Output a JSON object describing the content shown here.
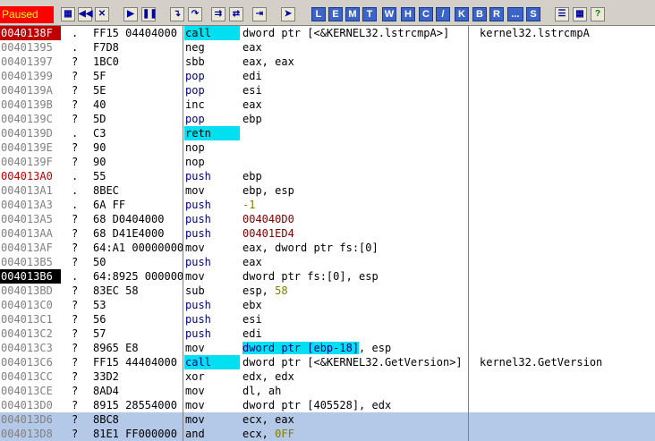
{
  "status": "Paused",
  "toolbar": {
    "buttons": [
      "open-icon",
      "rewind-icon",
      "close-icon",
      "run-icon",
      "pause-icon",
      "step-into-icon",
      "step-over-icon",
      "trace-into-icon",
      "trace-over-icon",
      "execute-till-return-icon",
      "goto-icon"
    ],
    "letters": [
      "L",
      "E",
      "M",
      "T",
      "W",
      "H",
      "C",
      "/",
      "K",
      "B",
      "R",
      "...",
      "S"
    ],
    "right_buttons": [
      "list-icon",
      "grid-icon",
      "help-icon"
    ]
  },
  "rows": [
    {
      "addr": "0040138F",
      "flag": ".",
      "hex": "FF15 04404000",
      "mn": "call",
      "ops": "dword ptr [<&KERNEL32.lstrcmpA>]",
      "cmt": "kernel32.lstrcmpA",
      "addr_style": "hl",
      "mn_style": "cyan"
    },
    {
      "addr": "00401395",
      "flag": ".",
      "hex": "F7D8",
      "mn": "neg",
      "ops": "eax",
      "cmt": ""
    },
    {
      "addr": "00401397",
      "flag": "?",
      "hex": "1BC0",
      "mn": "sbb",
      "ops": "eax, eax",
      "cmt": ""
    },
    {
      "addr": "00401399",
      "flag": "?",
      "hex": "5F",
      "mn": "pop",
      "ops": "edi",
      "cmt": "",
      "mn_style": "blue"
    },
    {
      "addr": "0040139A",
      "flag": "?",
      "hex": "5E",
      "mn": "pop",
      "ops": "esi",
      "cmt": "",
      "mn_style": "blue"
    },
    {
      "addr": "0040139B",
      "flag": "?",
      "hex": "40",
      "mn": "inc",
      "ops": "eax",
      "cmt": ""
    },
    {
      "addr": "0040139C",
      "flag": "?",
      "hex": "5D",
      "mn": "pop",
      "ops": "ebp",
      "cmt": "",
      "mn_style": "blue"
    },
    {
      "addr": "0040139D",
      "flag": ".",
      "hex": "C3",
      "mn": "retn",
      "ops": "",
      "cmt": "",
      "mn_style": "cyan"
    },
    {
      "addr": "0040139E",
      "flag": "?",
      "hex": "90",
      "mn": "nop",
      "ops": "",
      "cmt": ""
    },
    {
      "addr": "0040139F",
      "flag": "?",
      "hex": "90",
      "mn": "nop",
      "ops": "",
      "cmt": ""
    },
    {
      "addr": "004013A0",
      "flag": ".",
      "hex": "55",
      "mn": "push",
      "ops": "ebp",
      "cmt": "",
      "addr_style": "red",
      "mn_style": "blue"
    },
    {
      "addr": "004013A1",
      "flag": ".",
      "hex": "8BEC",
      "mn": "mov",
      "ops": "ebp, esp",
      "cmt": ""
    },
    {
      "addr": "004013A3",
      "flag": ".",
      "hex": "6A FF",
      "mn": "push",
      "ops": "-1",
      "cmt": "",
      "mn_style": "blue",
      "ops_style": "num"
    },
    {
      "addr": "004013A5",
      "flag": "?",
      "hex": "68 D0404000",
      "mn": "push",
      "ops": "004040D0",
      "cmt": "",
      "mn_style": "blue",
      "ops_style": "imm"
    },
    {
      "addr": "004013AA",
      "flag": "?",
      "hex": "68 D41E4000",
      "mn": "push",
      "ops": "00401ED4",
      "cmt": "",
      "mn_style": "blue",
      "ops_style": "imm"
    },
    {
      "addr": "004013AF",
      "flag": "?",
      "hex": "64:A1 00000000",
      "mn": "mov",
      "ops": "eax, dword ptr fs:[0]",
      "cmt": ""
    },
    {
      "addr": "004013B5",
      "flag": "?",
      "hex": "50",
      "mn": "push",
      "ops": "eax",
      "cmt": "",
      "mn_style": "blue"
    },
    {
      "addr": "004013B6",
      "flag": ".",
      "hex": "64:8925 00000000",
      "mn": "mov",
      "ops": "dword ptr fs:[0], esp",
      "cmt": "",
      "addr_style": "blk"
    },
    {
      "addr": "004013BD",
      "flag": "?",
      "hex": "83EC 58",
      "mn": "sub",
      "ops_pre": "esp, ",
      "ops_num": "58",
      "cmt": ""
    },
    {
      "addr": "004013C0",
      "flag": "?",
      "hex": "53",
      "mn": "push",
      "ops": "ebx",
      "cmt": "",
      "mn_style": "blue"
    },
    {
      "addr": "004013C1",
      "flag": "?",
      "hex": "56",
      "mn": "push",
      "ops": "esi",
      "cmt": "",
      "mn_style": "blue"
    },
    {
      "addr": "004013C2",
      "flag": "?",
      "hex": "57",
      "mn": "push",
      "ops": "edi",
      "cmt": "",
      "mn_style": "blue"
    },
    {
      "addr": "004013C3",
      "flag": "?",
      "hex": "8965 E8",
      "mn": "mov",
      "ops_hl": "dword ptr [ebp-18]",
      "ops_post": ", esp",
      "cmt": ""
    },
    {
      "addr": "004013C6",
      "flag": "?",
      "hex": "FF15 44404000",
      "mn": "call",
      "ops": "dword ptr [<&KERNEL32.GetVersion>]",
      "cmt": "kernel32.GetVersion",
      "mn_style": "cyanblue"
    },
    {
      "addr": "004013CC",
      "flag": "?",
      "hex": "33D2",
      "mn": "xor",
      "ops": "edx, edx",
      "cmt": ""
    },
    {
      "addr": "004013CE",
      "flag": "?",
      "hex": "8AD4",
      "mn": "mov",
      "ops": "dl, ah",
      "cmt": ""
    },
    {
      "addr": "004013D0",
      "flag": "?",
      "hex": "8915 28554000",
      "mn": "mov",
      "ops": "dword ptr [405528], edx",
      "cmt": ""
    },
    {
      "addr": "004013D6",
      "flag": "?",
      "hex": "8BC8",
      "mn": "mov",
      "ops": "ecx, eax",
      "cmt": "",
      "selected": true
    },
    {
      "addr": "004013D8",
      "flag": "?",
      "hex": "81E1 FF000000",
      "mn": "and",
      "ops_pre": "ecx, ",
      "ops_num": "0FF",
      "cmt": "",
      "selected": true
    }
  ]
}
